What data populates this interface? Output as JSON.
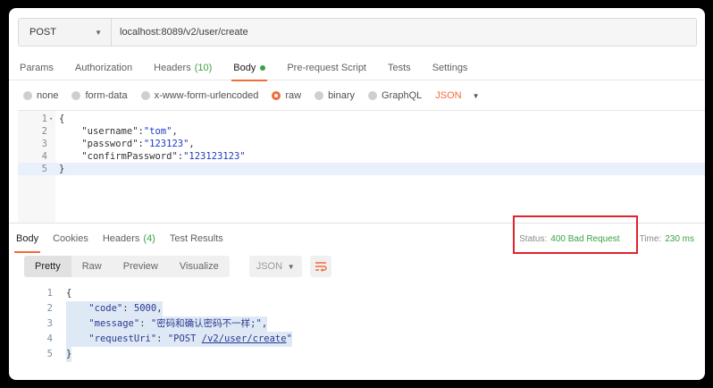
{
  "request": {
    "method": "POST",
    "url": "localhost:8089/v2/user/create"
  },
  "request_tabs": [
    {
      "label": "Params"
    },
    {
      "label": "Authorization"
    },
    {
      "label": "Headers",
      "count": "(10)"
    },
    {
      "label": "Body",
      "active": true,
      "indicator": "green"
    },
    {
      "label": "Pre-request Script"
    },
    {
      "label": "Tests"
    },
    {
      "label": "Settings"
    }
  ],
  "body_types": {
    "options": [
      "none",
      "form-data",
      "x-www-form-urlencoded",
      "raw",
      "binary",
      "GraphQL"
    ],
    "selected": "raw",
    "format": "JSON"
  },
  "request_body": {
    "line_numbers": [
      "1",
      "2",
      "3",
      "4",
      "5"
    ],
    "open_brace": "{",
    "close_brace": "}",
    "username_key": "\"username\"",
    "username_value": "\"tom\"",
    "password_key": "\"password\"",
    "password_value": "\"123123\"",
    "confirm_key": "\"confirmPassword\"",
    "confirm_value": "\"123123123\""
  },
  "response_tabs": [
    {
      "label": "Body",
      "active": true
    },
    {
      "label": "Cookies"
    },
    {
      "label": "Headers",
      "count": "(4)"
    },
    {
      "label": "Test Results"
    }
  ],
  "status": {
    "status_label": "Status:",
    "status_value": "400 Bad Request",
    "time_label": "Time:",
    "time_value": "230 ms"
  },
  "response_view": {
    "modes": [
      "Pretty",
      "Raw",
      "Preview",
      "Visualize"
    ],
    "active": "Pretty",
    "format": "JSON"
  },
  "response_body": {
    "line_numbers": [
      "1",
      "2",
      "3",
      "4",
      "5"
    ],
    "open_brace": "{",
    "close_brace": "}",
    "code_key": "\"code\"",
    "code_value": "5000",
    "message_key": "\"message\"",
    "message_value": "\"密码和确认密码不一样;\"",
    "uri_key": "\"requestUri\"",
    "uri_prefix": "\"POST ",
    "uri_path": "/v2/user/create",
    "uri_suffix": "\""
  },
  "colors": {
    "accent": "#f26b3a",
    "success": "#3aa245",
    "highlight_box": "#e0232e"
  }
}
